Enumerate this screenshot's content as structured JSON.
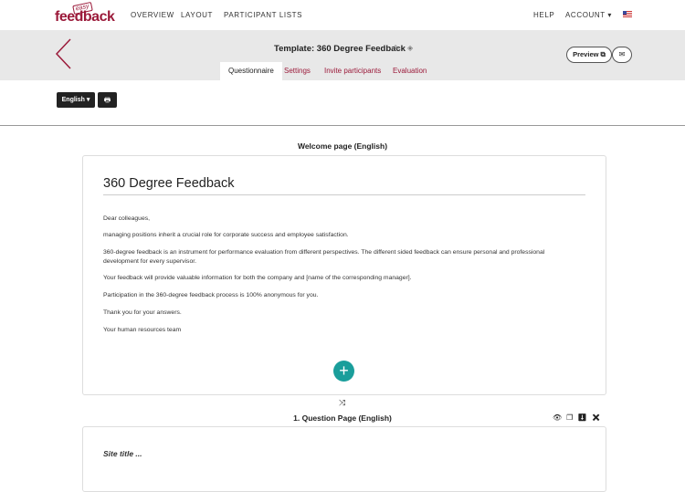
{
  "topnav": {
    "logo_small": "easy",
    "logo_main": "feedback",
    "links": [
      "OVERVIEW",
      "LAYOUT",
      "PARTICIPANT LISTS"
    ],
    "help": "HELP",
    "account": "ACCOUNT ▾",
    "flag_icon": "us-flag-icon"
  },
  "header": {
    "title": "Template: 360 Degree Feedback",
    "tabs": [
      "Questionnaire",
      "Settings",
      "Invite participants",
      "Evaluation"
    ],
    "active_tab": "Questionnaire",
    "preview_label": "Preview ⧉",
    "mail_icon": "✉",
    "accent_color": "#9b1a3a"
  },
  "toolbar": {
    "language": "English ▾",
    "print_icon": "🖶"
  },
  "welcome": {
    "heading": "Welcome page (English)",
    "title": "360 Degree Feedback",
    "paragraphs": [
      "Dear colleagues,",
      "managing positions inherit a crucial role for corporate success and employee satisfaction.",
      "360-degree feedback is an instrument for performance evaluation from different perspectives. The different sided feedback can ensure personal and professional development for every supervisor.",
      "Your feedback will provide valuable information for both the company and [name of the corresponding manager].",
      "Participation in the 360-degree feedback process is 100% anonymous for you.",
      "Thank you for your answers.",
      "Your human resources team"
    ],
    "add_color": "#1a9e9b"
  },
  "question_page": {
    "heading": "1. Question Page (English)",
    "site_title": "Site title ..."
  }
}
